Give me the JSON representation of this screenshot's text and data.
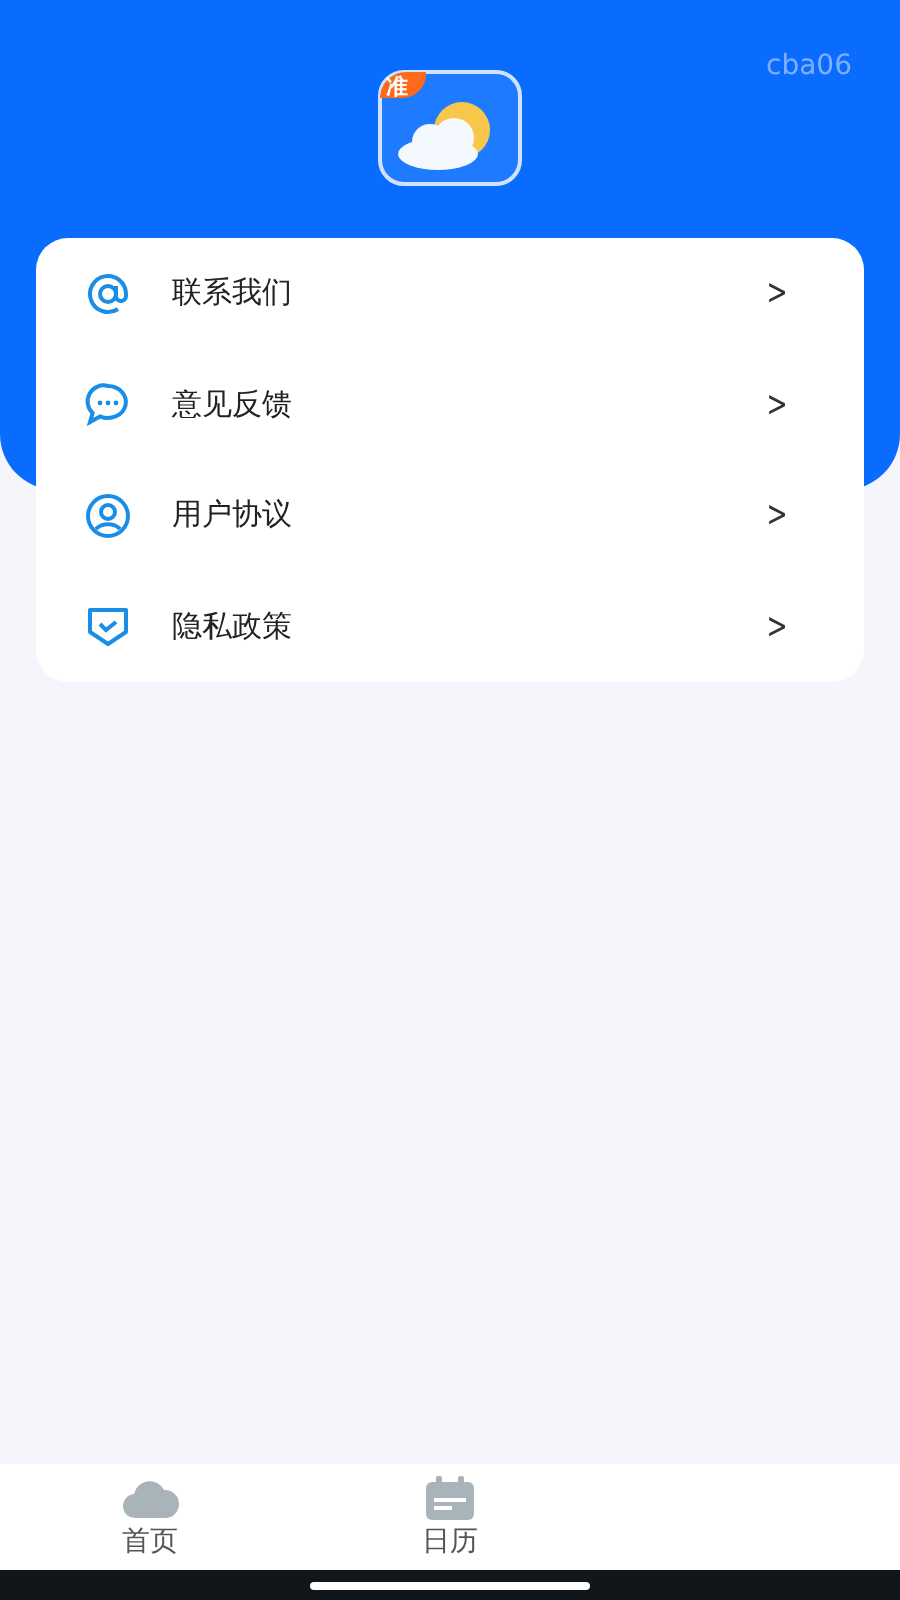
{
  "header": {
    "version": "cba06",
    "app_icon": {
      "badge": "准"
    }
  },
  "menu": [
    {
      "kind": "contact",
      "label": "联系我们",
      "chevron": ">"
    },
    {
      "kind": "feedback",
      "label": "意见反馈",
      "chevron": ">"
    },
    {
      "kind": "agreement",
      "label": "用户协议",
      "chevron": ">"
    },
    {
      "kind": "privacy",
      "label": "隐私政策",
      "chevron": ">"
    }
  ],
  "tab_bar": [
    {
      "kind": "home",
      "label": "首页",
      "selected": false
    },
    {
      "kind": "calendar",
      "label": "日历",
      "selected": false
    }
  ]
}
